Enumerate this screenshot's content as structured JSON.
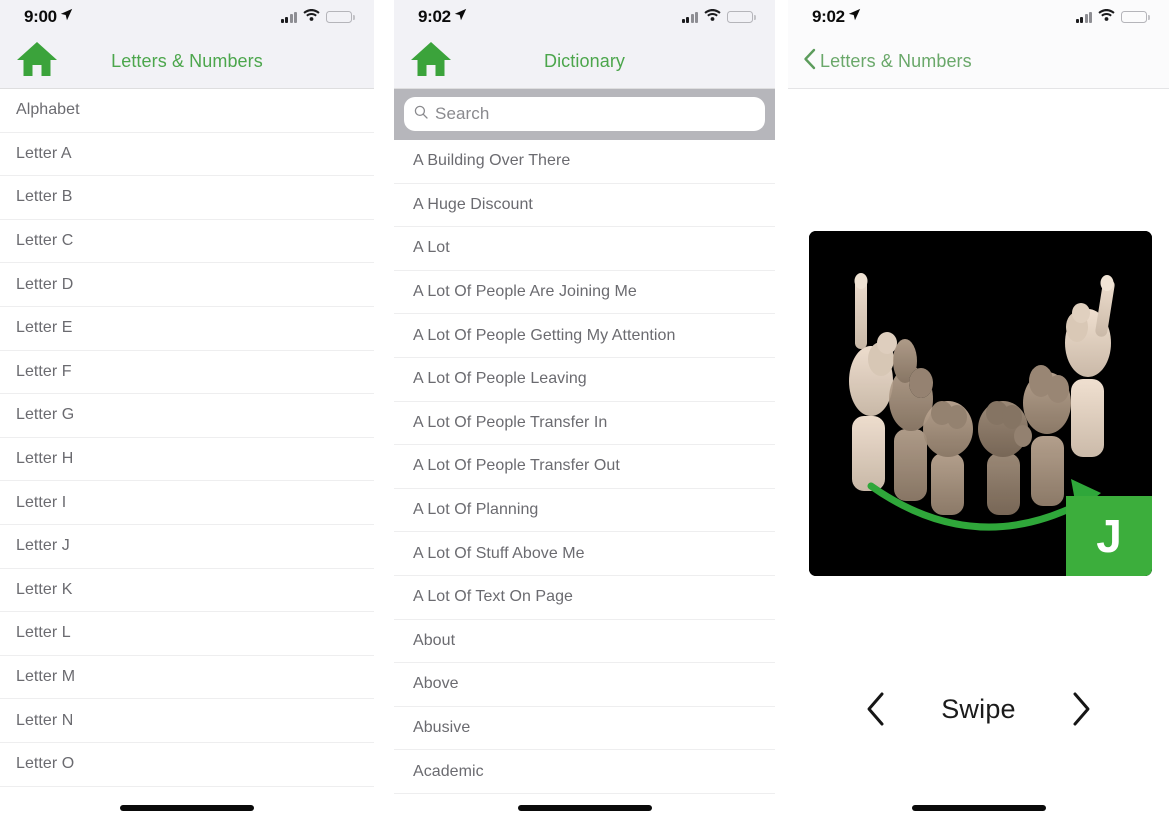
{
  "app": {
    "accent_green": "#4ca64c",
    "badge_green": "#3cae3c",
    "battery_yellow": "#f6cc33",
    "list_text_color": "#6b6b70"
  },
  "screen_left": {
    "status": {
      "time": "9:00",
      "location_icon": "location-arrow-icon",
      "signal_icon": "cellular-signal-icon",
      "wifi_icon": "wifi-icon",
      "battery_icon": "battery-low-power-icon"
    },
    "nav": {
      "home_icon": "home-icon",
      "title": "Letters & Numbers"
    },
    "list": [
      {
        "label": "Alphabet"
      },
      {
        "label": "Letter A"
      },
      {
        "label": "Letter B"
      },
      {
        "label": "Letter C"
      },
      {
        "label": "Letter D"
      },
      {
        "label": "Letter E"
      },
      {
        "label": "Letter F"
      },
      {
        "label": "Letter G"
      },
      {
        "label": "Letter H"
      },
      {
        "label": "Letter I"
      },
      {
        "label": "Letter J"
      },
      {
        "label": "Letter K"
      },
      {
        "label": "Letter L"
      },
      {
        "label": "Letter M"
      },
      {
        "label": "Letter N"
      },
      {
        "label": "Letter O"
      }
    ]
  },
  "screen_middle": {
    "status": {
      "time": "9:02",
      "location_icon": "location-arrow-icon",
      "signal_icon": "cellular-signal-icon",
      "wifi_icon": "wifi-icon",
      "battery_icon": "battery-low-power-icon"
    },
    "nav": {
      "home_icon": "home-icon",
      "title": "Dictionary"
    },
    "search": {
      "icon": "search-icon",
      "placeholder": "Search",
      "value": ""
    },
    "list": [
      {
        "label": "A Building Over There"
      },
      {
        "label": "A Huge Discount"
      },
      {
        "label": "A Lot"
      },
      {
        "label": "A Lot Of People Are Joining Me"
      },
      {
        "label": "A Lot Of People Getting My Attention"
      },
      {
        "label": "A Lot Of People Leaving"
      },
      {
        "label": "A Lot Of People Transfer In"
      },
      {
        "label": "A Lot Of People Transfer Out"
      },
      {
        "label": "A Lot Of Planning"
      },
      {
        "label": "A Lot Of Stuff Above Me"
      },
      {
        "label": "A Lot Of Text On Page"
      },
      {
        "label": "About"
      },
      {
        "label": "Above"
      },
      {
        "label": "Abusive"
      },
      {
        "label": "Academic"
      }
    ]
  },
  "screen_right": {
    "status": {
      "time": "9:02",
      "location_icon": "location-arrow-icon",
      "signal_icon": "cellular-signal-icon",
      "wifi_icon": "wifi-icon",
      "battery_icon": "battery-low-power-icon"
    },
    "nav": {
      "back_icon": "chevron-left-icon",
      "back_label": "Letters & Numbers"
    },
    "sign": {
      "image_alt": "sign-language-hands-motion-sequence",
      "motion_arrow_icon": "curved-arrow-icon",
      "badge_letter": "J"
    },
    "controls": {
      "prev_icon": "chevron-left-icon",
      "label": "Swipe",
      "next_icon": "chevron-right-icon"
    }
  }
}
